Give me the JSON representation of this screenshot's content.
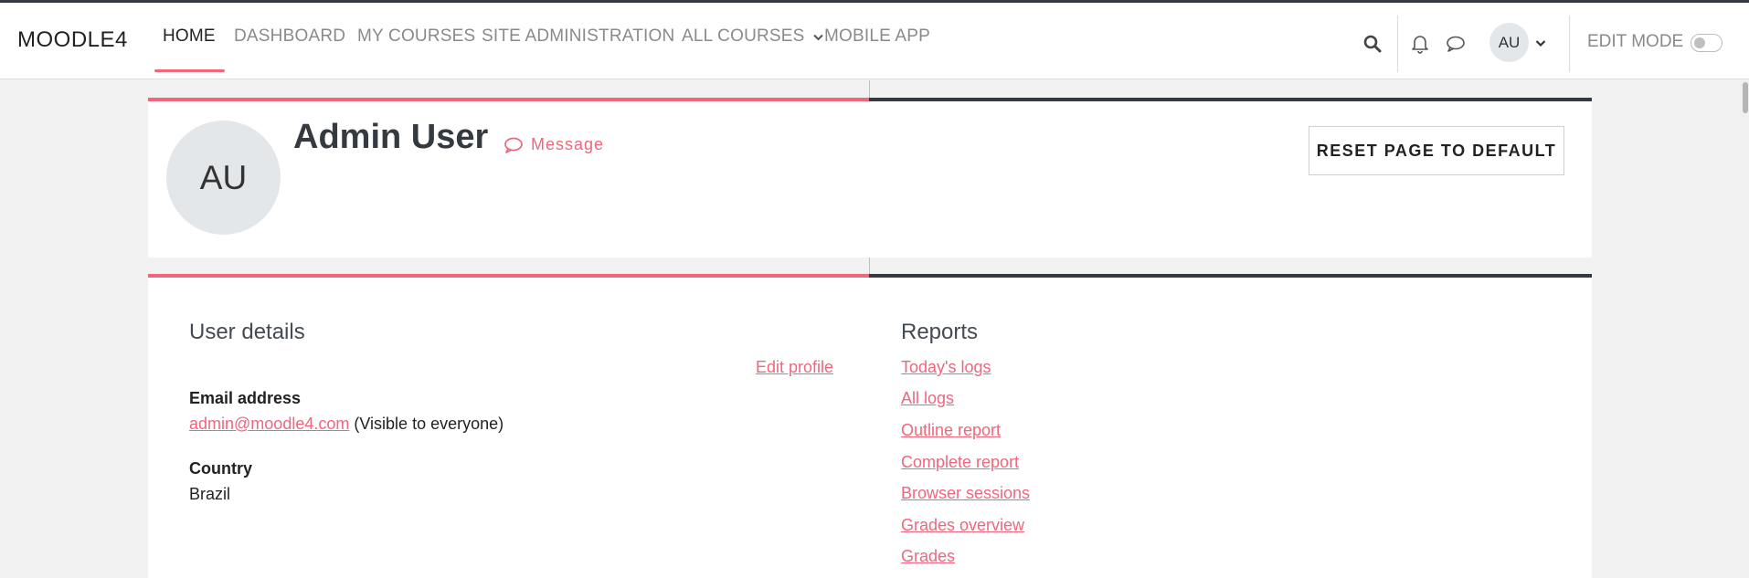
{
  "navbar": {
    "brand": "MOODLE4",
    "items": [
      {
        "label": "HOME"
      },
      {
        "label": "DASHBOARD"
      },
      {
        "label": "MY COURSES"
      },
      {
        "label": "SITE ADMINISTRATION"
      },
      {
        "label": "ALL COURSES"
      },
      {
        "label": "MOBILE APP"
      }
    ],
    "user_initials": "AU",
    "edit_mode_label": "EDIT MODE",
    "edit_mode_on": false
  },
  "profile": {
    "initials": "AU",
    "name": "Admin User",
    "message_label": "Message",
    "reset_button": "RESET PAGE TO DEFAULT"
  },
  "user_details": {
    "title": "User details",
    "edit_profile": "Edit profile",
    "email_label": "Email address",
    "email": "admin@moodle4.com",
    "email_visibility": "(Visible to everyone)",
    "country_label": "Country",
    "country": "Brazil"
  },
  "reports": {
    "title": "Reports",
    "links": [
      "Today's logs",
      "All logs",
      "Outline report",
      "Complete report",
      "Browser sessions",
      "Grades overview",
      "Grades"
    ]
  },
  "colors": {
    "accent": "#f0667d",
    "dark": "#343a40"
  }
}
